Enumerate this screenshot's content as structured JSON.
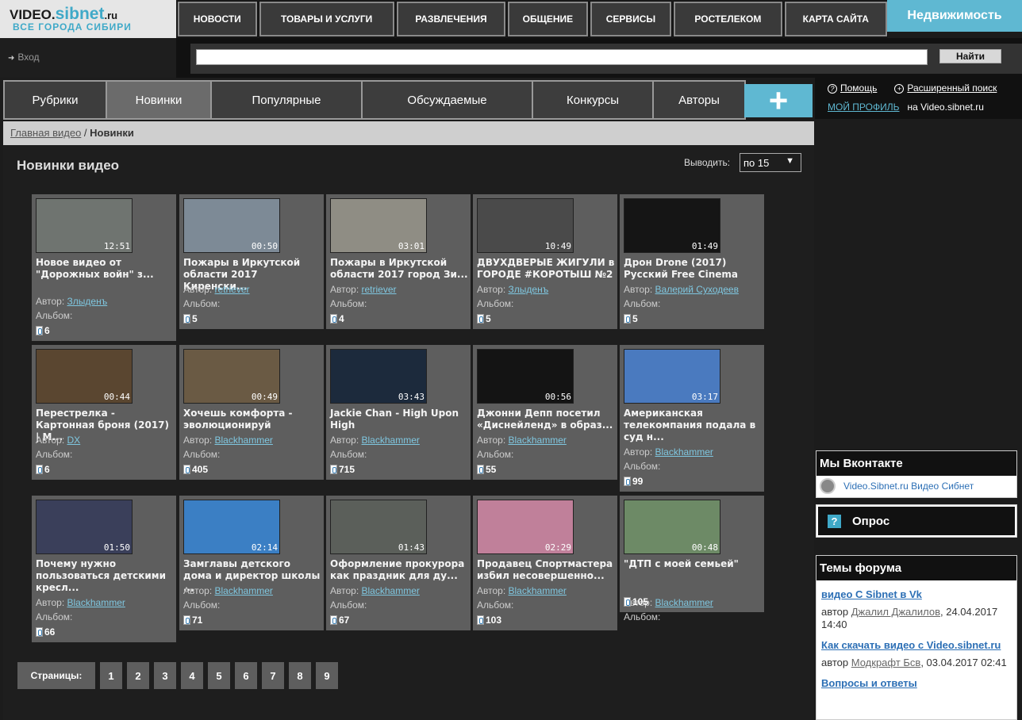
{
  "logo": {
    "part1": "VIDEO.",
    "part2": "sibnet",
    "part3": ".ru",
    "tagline": "ВСЕ ГОРОДА СИБИРИ"
  },
  "topnav": [
    "НОВОСТИ",
    "ТОВАРЫ И УСЛУГИ",
    "РАЗВЛЕЧЕНИЯ",
    "ОБЩЕНИЕ",
    "СЕРВИСЫ",
    "РОСТЕЛЕКОМ",
    "КАРТА САЙТА"
  ],
  "realty": "Недвижимость",
  "login": "Вход",
  "search": {
    "value": "",
    "button": "Найти"
  },
  "secnav": [
    "Рубрики",
    "Новинки",
    "Популярные",
    "Обсуждаемые",
    "Конкурсы",
    "Авторы"
  ],
  "plus": "+",
  "right_top": {
    "help": "Помощь",
    "adv_search": "Расширенный поиск",
    "my_profile": "МОЙ ПРОФИЛЬ",
    "on_site": "на Video.sibnet.ru"
  },
  "breadcrumb": {
    "home": "Главная видео",
    "sep": " / ",
    "current": "Новинки"
  },
  "page_title": "Новинки видео",
  "perpage": {
    "label": "Выводить:",
    "value": "по 15"
  },
  "labels": {
    "author": "Автор:",
    "album": "Альбом:"
  },
  "videos": [
    {
      "title": "Новое видео от \"Дорожных войн\" з...",
      "duration": "12:51",
      "author": "Злыденъ",
      "views": "6",
      "color": "#6f7470"
    },
    {
      "title": "Пожары в Иркутской области 2017 Киренски...",
      "duration": "00:50",
      "author": "retriever",
      "views": "5",
      "color": "#7d8a96"
    },
    {
      "title": "Пожары в Иркутской области 2017 город Зи...",
      "duration": "03:01",
      "author": "retriever",
      "views": "4",
      "color": "#8f8d84"
    },
    {
      "title": "ДВУХДВЕРЫЕ ЖИГУЛИ в ГОРОДЕ #КОРОТЫШ №2",
      "duration": "10:49",
      "author": "Злыденъ",
      "views": "5",
      "color": "#4a4a4a"
    },
    {
      "title": "Дрон Drone (2017) Русский Free Cinema",
      "duration": "01:49",
      "author": "Валерий Суходеев",
      "views": "5",
      "color": "#151515"
    },
    {
      "title": "Перестрелка - Картонная броня (2017) | М...",
      "duration": "00:44",
      "author": "DX",
      "views": "6",
      "color": "#5a4630"
    },
    {
      "title": "Хочешь комфорта - эволюционируй",
      "duration": "00:49",
      "author": "Blackhammer",
      "views": "405",
      "color": "#6a5a44"
    },
    {
      "title": "Jackie Chan - High Upon High",
      "duration": "03:43",
      "author": "Blackhammer",
      "views": "715",
      "color": "#1c2a3c"
    },
    {
      "title": "Джонни Депп посетил «Диснейленд» в образ...",
      "duration": "00:56",
      "author": "Blackhammer",
      "views": "55",
      "color": "#141414"
    },
    {
      "title": "Американская телекомпания подала в суд н...",
      "duration": "03:17",
      "author": "Blackhammer",
      "views": "99",
      "color": "#4a7abf"
    },
    {
      "title": "Почему нужно пользоваться детскими кресл...",
      "duration": "01:50",
      "author": "Blackhammer",
      "views": "66",
      "color": "#3a3f5a"
    },
    {
      "title": "Замглавы детского дома и директор школы ...",
      "duration": "02:14",
      "author": "Blackhammer",
      "views": "71",
      "color": "#3b7fc4"
    },
    {
      "title": "Оформление прокурора как праздник для ду...",
      "duration": "01:43",
      "author": "Blackhammer",
      "views": "67",
      "color": "#5b5f5a"
    },
    {
      "title": "Продавец Спортмастера избил несовершенно...",
      "duration": "02:29",
      "author": "Blackhammer",
      "views": "103",
      "color": "#c0809a"
    },
    {
      "title": "\"ДТП с моей семьей\"",
      "duration": "00:48",
      "author": "Blackhammer",
      "views": "105",
      "color": "#6d8a66"
    }
  ],
  "pager": {
    "label": "Страницы:",
    "pages": [
      "1",
      "2",
      "3",
      "4",
      "5",
      "6",
      "7",
      "8",
      "9"
    ]
  },
  "vk": {
    "title": "Мы Вконтакте",
    "link": "Video.Sibnet.ru Видео Сибнет"
  },
  "poll": {
    "title": "Опрос",
    "icon": "?"
  },
  "forum": {
    "title": "Темы форума",
    "by": "автор",
    "topics": [
      {
        "title": "видео С Sibnet в Vk",
        "author": "Джалил Джалилов",
        "date": ", 24.04.2017 14:40"
      },
      {
        "title": "Как скачать видео с Video.sibnet.ru",
        "author": "Модкрафт Бсв",
        "date": ", 03.04.2017 02:41"
      },
      {
        "title": "Вопросы и ответы",
        "author": "",
        "date": ""
      }
    ]
  }
}
